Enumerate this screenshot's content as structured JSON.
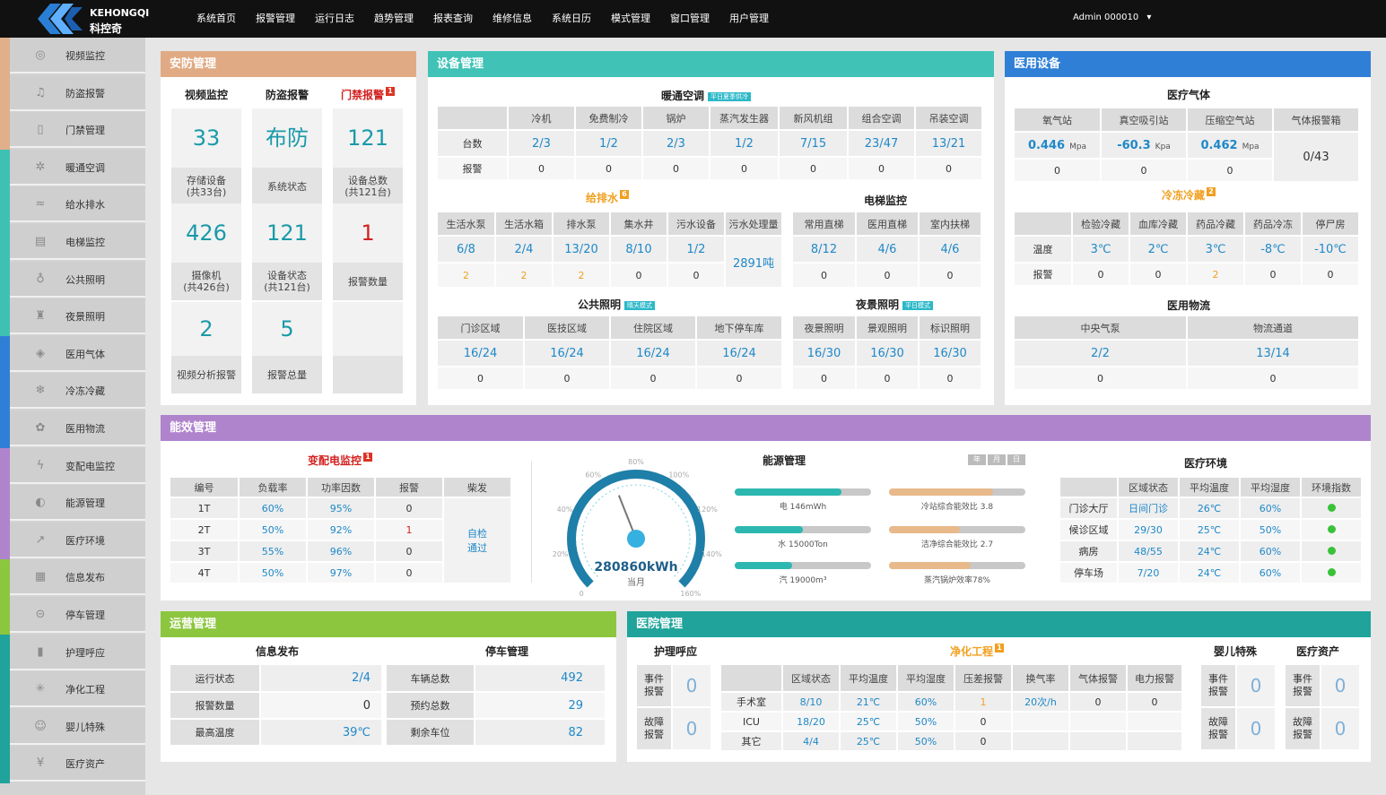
{
  "brand": {
    "en": "KEHONGQI",
    "cn": "科控奇"
  },
  "nav": [
    "系统首页",
    "报警管理",
    "运行日志",
    "趋势管理",
    "报表查询",
    "维修信息",
    "系统日历",
    "模式管理",
    "窗口管理",
    "用户管理"
  ],
  "user": "Admin 000010",
  "sidebar": [
    {
      "label": "视频监控",
      "color": "#e0b08a",
      "icon": "camera-icon"
    },
    {
      "label": "防盗报警",
      "color": "#e0b08a",
      "icon": "bell-icon"
    },
    {
      "label": "门禁管理",
      "color": "#e0b08a",
      "icon": "door-icon"
    },
    {
      "label": "暖通空调",
      "color": "#3ec1b3",
      "icon": "fan-icon"
    },
    {
      "label": "给水排水",
      "color": "#3ec1b3",
      "icon": "water-icon"
    },
    {
      "label": "电梯监控",
      "color": "#3ec1b3",
      "icon": "elevator-icon"
    },
    {
      "label": "公共照明",
      "color": "#3ec1b3",
      "icon": "bulb-icon"
    },
    {
      "label": "夜景照明",
      "color": "#3ec1b3",
      "icon": "lamp-icon"
    },
    {
      "label": "医用气体",
      "color": "#2f7fd6",
      "icon": "gas-icon"
    },
    {
      "label": "冷冻冷藏",
      "color": "#2f7fd6",
      "icon": "snowflake-icon"
    },
    {
      "label": "医用物流",
      "color": "#2f7fd6",
      "icon": "logistics-icon"
    },
    {
      "label": "变配电监控",
      "color": "#b084cc",
      "icon": "power-icon"
    },
    {
      "label": "能源管理",
      "color": "#b084cc",
      "icon": "energy-icon"
    },
    {
      "label": "医疗环境",
      "color": "#b084cc",
      "icon": "chart-icon"
    },
    {
      "label": "信息发布",
      "color": "#8cc63f",
      "icon": "info-icon"
    },
    {
      "label": "停车管理",
      "color": "#8cc63f",
      "icon": "car-icon"
    },
    {
      "label": "护理呼应",
      "color": "#1fa39a",
      "icon": "call-icon"
    },
    {
      "label": "净化工程",
      "color": "#1fa39a",
      "icon": "purify-icon"
    },
    {
      "label": "婴儿特殊",
      "color": "#1fa39a",
      "icon": "baby-icon"
    },
    {
      "label": "医疗资产",
      "color": "#1fa39a",
      "icon": "asset-icon"
    }
  ],
  "security": {
    "title": "安防管理",
    "cols": [
      "视频监控",
      "防盗报警",
      "门禁报警"
    ],
    "badge": "1",
    "grid": [
      [
        {
          "v": "33",
          "l": "存储设备\n(共33台)"
        },
        {
          "v": "布防",
          "l": "系统状态"
        },
        {
          "v": "121",
          "l": "设备总数\n(共121台)"
        }
      ],
      [
        {
          "v": "426",
          "l": "摄像机\n(共426台)"
        },
        {
          "v": "121",
          "l": "设备状态\n(共121台)"
        },
        {
          "v": "1",
          "l": "报警数量"
        }
      ],
      [
        {
          "v": "2",
          "l": "视频分析报警"
        },
        {
          "v": "5",
          "l": "报警总量"
        },
        {
          "v": "",
          "l": ""
        }
      ]
    ]
  },
  "equipment": {
    "title": "设备管理",
    "hvac": {
      "title": "暖通空调",
      "mode": "平日夏季供冷",
      "cols": [
        "冷机",
        "免费制冷",
        "锅炉",
        "蒸汽发生器",
        "新风机组",
        "组合空调",
        "吊装空调"
      ],
      "rows": [
        {
          "name": "台数",
          "vals": [
            "2/3",
            "1/2",
            "2/3",
            "1/2",
            "7/15",
            "23/47",
            "13/21"
          ]
        },
        {
          "name": "报警",
          "vals": [
            "0",
            "0",
            "0",
            "0",
            "0",
            "0",
            "0"
          ]
        }
      ]
    },
    "water": {
      "title": "给排水",
      "badge": "6",
      "cols": [
        "生活水泵",
        "生活水箱",
        "排水泵",
        "集水井",
        "污水设备",
        "污水处理量"
      ],
      "r1": [
        "6/8",
        "2/4",
        "13/20",
        "8/10",
        "1/2",
        "2891吨"
      ],
      "r2": [
        "2",
        "2",
        "2",
        "0",
        "0"
      ]
    },
    "elevator": {
      "title": "电梯监控",
      "cols": [
        "常用直梯",
        "医用直梯",
        "室内扶梯"
      ],
      "r1": [
        "8/12",
        "4/6",
        "4/6"
      ],
      "r2": [
        "0",
        "0",
        "0"
      ]
    },
    "light": {
      "title": "公共照明",
      "mode": "晴天模式",
      "cols": [
        "门诊区域",
        "医技区域",
        "住院区域",
        "地下停车库"
      ],
      "r1": [
        "16/24",
        "16/24",
        "16/24",
        "16/24"
      ],
      "r2": [
        "0",
        "0",
        "0",
        "0"
      ]
    },
    "night": {
      "title": "夜景照明",
      "mode": "平日模式",
      "cols": [
        "夜景照明",
        "景观照明",
        "标识照明"
      ],
      "r1": [
        "16/30",
        "16/30",
        "16/30"
      ],
      "r2": [
        "0",
        "0",
        "0"
      ]
    }
  },
  "medical": {
    "title": "医用设备",
    "gas": {
      "title": "医疗气体",
      "cols": [
        "氧气站",
        "真空吸引站",
        "压缩空气站",
        "气体报警箱"
      ],
      "vals": [
        {
          "v": "0.446",
          "u": "Mpa"
        },
        {
          "v": "-60.3",
          "u": "Kpa"
        },
        {
          "v": "0.462",
          "u": "Mpa"
        }
      ],
      "alarm": "0/43",
      "r2": [
        "0",
        "0",
        "0"
      ]
    },
    "cold": {
      "title": "冷冻冷藏",
      "badge": "2",
      "cols": [
        "检验冷藏",
        "血库冷藏",
        "药品冷藏",
        "药品冷冻",
        "停尸房"
      ],
      "r1name": "温度",
      "r1": [
        "3℃",
        "2℃",
        "3℃",
        "-8℃",
        "-10℃"
      ],
      "r2name": "报警",
      "r2": [
        "0",
        "0",
        "2",
        "0",
        "0"
      ]
    },
    "logistics": {
      "title": "医用物流",
      "cols": [
        "中央气泵",
        "物流通道"
      ],
      "r1": [
        "2/2",
        "13/14"
      ],
      "r2": [
        "0",
        "0"
      ]
    }
  },
  "energy": {
    "title": "能效管理",
    "power": {
      "title": "变配电监控",
      "badge": "1",
      "cols": [
        "编号",
        "负载率",
        "功率因数",
        "报警",
        "柴发"
      ],
      "rows": [
        [
          "1T",
          "60%",
          "95%",
          "0"
        ],
        [
          "2T",
          "50%",
          "92%",
          "1"
        ],
        [
          "3T",
          "55%",
          "96%",
          "0"
        ],
        [
          "4T",
          "50%",
          "97%",
          "0"
        ]
      ],
      "gen": "自检\n通过"
    },
    "gauge": {
      "value": "280860kWh",
      "sub": "当月",
      "ticks": [
        "0",
        "20%",
        "40%",
        "60%",
        "80%",
        "100%",
        "120%",
        "140%",
        "160%"
      ],
      "level": 0.42
    },
    "mgmt": {
      "title": "能源管理",
      "periods": [
        "年",
        "月",
        "日"
      ],
      "bars": [
        {
          "label": "电 146mWh",
          "level": 0.78,
          "color": "#2cb8b0"
        },
        {
          "label": "冷站综合能效比 3.8",
          "level": 0.76,
          "color": "#e8b98a"
        },
        {
          "label": "水 15000Ton",
          "level": 0.5,
          "color": "#2cb8b0"
        },
        {
          "label": "洁净综合能效比 2.7",
          "level": 0.52,
          "color": "#e8b98a"
        },
        {
          "label": "汽 19000m³",
          "level": 0.42,
          "color": "#2cb8b0"
        },
        {
          "label": "蒸汽锅炉效率78%",
          "level": 0.6,
          "color": "#e8b98a"
        }
      ]
    },
    "env": {
      "title": "医疗环境",
      "cols": [
        "区域状态",
        "平均温度",
        "平均湿度",
        "环境指数"
      ],
      "rows": [
        [
          "门诊大厅",
          "日间门诊",
          "26℃",
          "60%"
        ],
        [
          "候诊区域",
          "29/30",
          "25℃",
          "50%"
        ],
        [
          "病房",
          "48/55",
          "24℃",
          "60%"
        ],
        [
          "停车场",
          "7/20",
          "24℃",
          "60%"
        ]
      ]
    }
  },
  "ops": {
    "title": "运营管理",
    "info": {
      "title": "信息发布",
      "rows": [
        [
          "运行状态",
          "2/4"
        ],
        [
          "报警数量",
          "0"
        ],
        [
          "最高温度",
          "39℃"
        ]
      ]
    },
    "park": {
      "title": "停车管理",
      "rows": [
        [
          "车辆总数",
          "492"
        ],
        [
          "预约总数",
          "29"
        ],
        [
          "剩余车位",
          "82"
        ]
      ]
    }
  },
  "hospital": {
    "title": "医院管理",
    "nurse": {
      "title": "护理呼应",
      "rows": [
        [
          "事件\n报警",
          "0"
        ],
        [
          "故障\n报警",
          "0"
        ]
      ]
    },
    "clean": {
      "title": "净化工程",
      "badge": "1",
      "cols": [
        "区域状态",
        "平均温度",
        "平均湿度",
        "压差报警",
        "换气率",
        "气体报警",
        "电力报警"
      ],
      "rows": [
        [
          "手术室",
          "8/10",
          "21℃",
          "60%",
          "1",
          "20次/h",
          "0",
          "0"
        ],
        [
          "ICU",
          "18/20",
          "25℃",
          "50%",
          "0",
          "",
          "",
          ""
        ],
        [
          "其它",
          "4/4",
          "25℃",
          "50%",
          "0",
          "",
          "",
          ""
        ]
      ]
    },
    "baby": {
      "title": "婴儿特殊",
      "rows": [
        [
          "事件\n报警",
          "0"
        ],
        [
          "故障\n报警",
          "0"
        ]
      ]
    },
    "asset": {
      "title": "医疗资产",
      "rows": [
        [
          "事件\n报警",
          "0"
        ],
        [
          "故障\n报警",
          "0"
        ]
      ]
    }
  }
}
